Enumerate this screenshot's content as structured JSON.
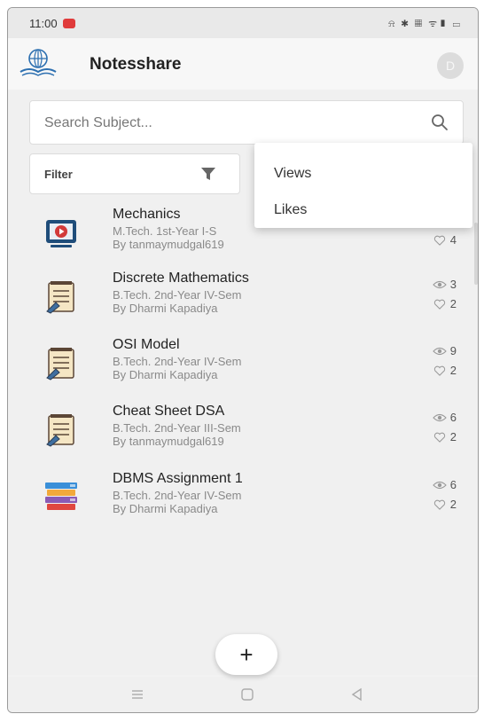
{
  "status_bar": {
    "time": "11:00",
    "icons_text": "⍾ ✱ ▦ ᯤ▮ ▭"
  },
  "app_bar": {
    "title": "Notesshare",
    "avatar_initial": "D"
  },
  "search": {
    "placeholder": "Search Subject..."
  },
  "filter": {
    "label": "Filter"
  },
  "sort_menu": {
    "items": [
      "Views",
      "Likes"
    ]
  },
  "notes": [
    {
      "title": "Mechanics",
      "subtitle": "M.Tech. 1st-Year I-S",
      "author": "By tanmaymudgal619",
      "views": "",
      "likes": "4",
      "icon": "video-lecture-icon"
    },
    {
      "title": "Discrete Mathematics",
      "subtitle": "B.Tech. 2nd-Year IV-Sem",
      "author": "By Dharmi Kapadiya",
      "views": "3",
      "likes": "2",
      "icon": "notepad-icon"
    },
    {
      "title": "OSI Model",
      "subtitle": "B.Tech. 2nd-Year IV-Sem",
      "author": "By Dharmi Kapadiya",
      "views": "9",
      "likes": "2",
      "icon": "notepad-icon"
    },
    {
      "title": "Cheat Sheet DSA",
      "subtitle": "B.Tech. 2nd-Year III-Sem",
      "author": "By tanmaymudgal619",
      "views": "6",
      "likes": "2",
      "icon": "notepad-icon"
    },
    {
      "title": "DBMS Assignment 1",
      "subtitle": "B.Tech. 2nd-Year IV-Sem",
      "author": "By Dharmi Kapadiya",
      "views": "6",
      "likes": "2",
      "icon": "books-icon"
    }
  ],
  "fab": {
    "label": "+"
  },
  "colors": {
    "record_dot": "#e03b3b",
    "accent_blue": "#2c6fb0"
  }
}
